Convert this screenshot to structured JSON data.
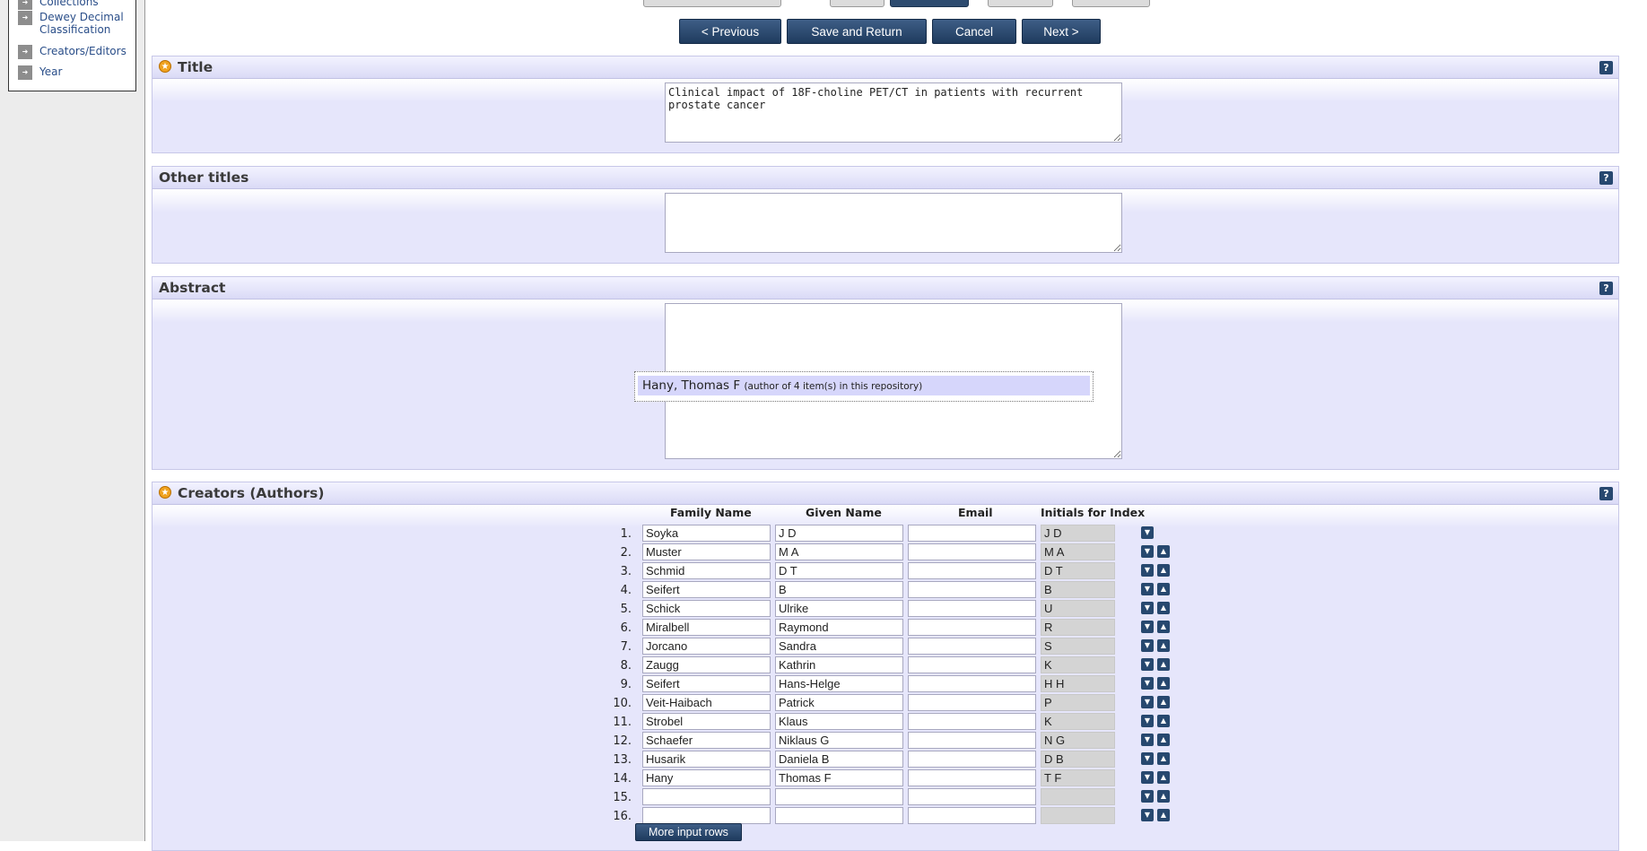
{
  "sidebar": {
    "items": [
      {
        "label": "Collections"
      },
      {
        "label": "Dewey Decimal Classification"
      },
      {
        "label": "Creators/Editors"
      },
      {
        "label": "Year"
      }
    ]
  },
  "workflow_buttons": {
    "previous": "< Previous",
    "save_return": "Save and Return",
    "cancel": "Cancel",
    "next": "Next >"
  },
  "title_panel": {
    "heading": "Title",
    "value": "Clinical impact of 18F-choline PET/CT in patients with recurrent prostate cancer"
  },
  "other_titles_panel": {
    "heading": "Other titles",
    "value": ""
  },
  "abstract_panel": {
    "heading": "Abstract",
    "value": ""
  },
  "autocomplete": {
    "name": "Hany, Thomas F",
    "note": "(author of 4 item(s) in this repository)"
  },
  "creators_panel": {
    "heading": "Creators (Authors)",
    "columns": {
      "family": "Family Name",
      "given": "Given Name",
      "email": "Email",
      "initials": "Initials for Index"
    },
    "rows": [
      {
        "num": "1.",
        "family": "Soyka",
        "given": "J D",
        "email": "",
        "initials": "J D"
      },
      {
        "num": "2.",
        "family": "Muster",
        "given": "M A",
        "email": "",
        "initials": "M A"
      },
      {
        "num": "3.",
        "family": "Schmid",
        "given": "D T",
        "email": "",
        "initials": "D T"
      },
      {
        "num": "4.",
        "family": "Seifert",
        "given": "B",
        "email": "",
        "initials": "B"
      },
      {
        "num": "5.",
        "family": "Schick",
        "given": "Ulrike",
        "email": "",
        "initials": "U"
      },
      {
        "num": "6.",
        "family": "Miralbell",
        "given": "Raymond",
        "email": "",
        "initials": "R"
      },
      {
        "num": "7.",
        "family": "Jorcano",
        "given": "Sandra",
        "email": "",
        "initials": "S"
      },
      {
        "num": "8.",
        "family": "Zaugg",
        "given": "Kathrin",
        "email": "",
        "initials": "K"
      },
      {
        "num": "9.",
        "family": "Seifert",
        "given": "Hans-Helge",
        "email": "",
        "initials": "H H"
      },
      {
        "num": "10.",
        "family": "Veit-Haibach",
        "given": "Patrick",
        "email": "",
        "initials": "P"
      },
      {
        "num": "11.",
        "family": "Strobel",
        "given": "Klaus",
        "email": "",
        "initials": "K"
      },
      {
        "num": "12.",
        "family": "Schaefer",
        "given": "Niklaus G",
        "email": "",
        "initials": "N G"
      },
      {
        "num": "13.",
        "family": "Husarik",
        "given": "Daniela B",
        "email": "",
        "initials": "D B"
      },
      {
        "num": "14.",
        "family": "Hany",
        "given": "Thomas F",
        "email": "",
        "initials": "T F"
      },
      {
        "num": "15.",
        "family": "",
        "given": "",
        "email": "",
        "initials": ""
      },
      {
        "num": "16.",
        "family": "",
        "given": "",
        "email": "",
        "initials": ""
      }
    ],
    "more_rows_label": "More input rows"
  },
  "colors": {
    "button": "#2d4b6f",
    "panel_bg": "#e6e6fb",
    "star": "#f0a21f",
    "link": "#2a4e89"
  },
  "icons": {
    "star": "required-star-icon",
    "help": "help-icon",
    "down": "move-down-icon",
    "up": "move-up-icon",
    "nav": "arrow-right-icon"
  }
}
